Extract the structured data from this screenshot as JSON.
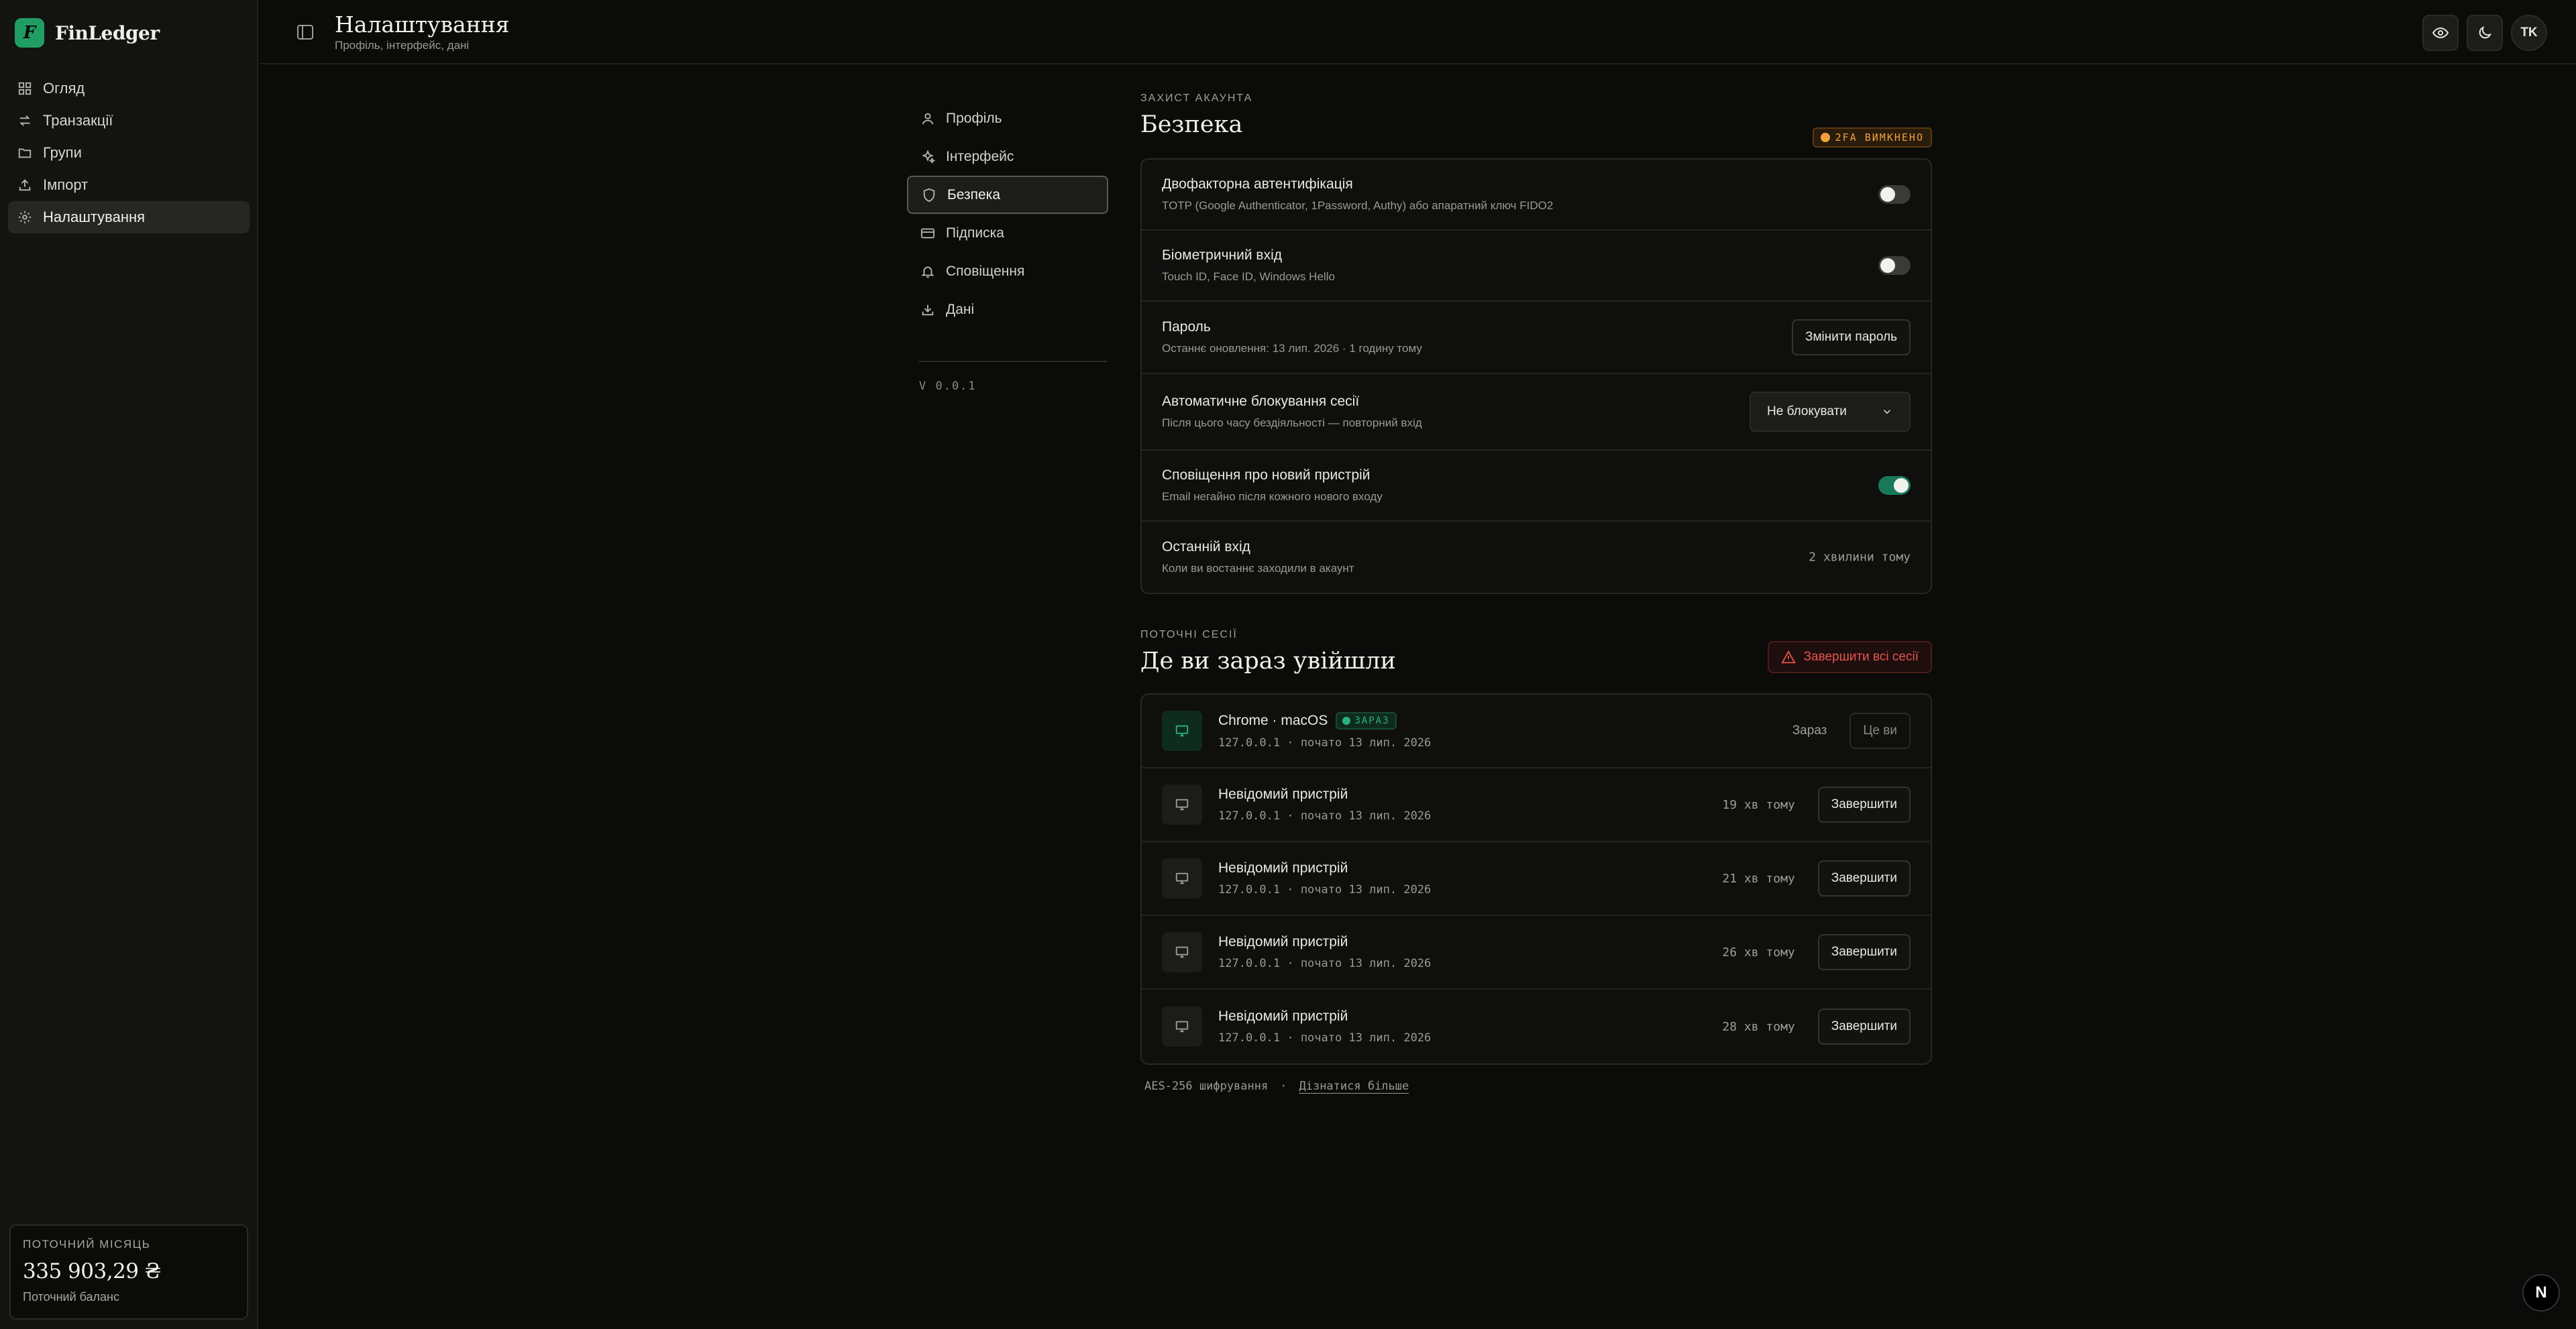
{
  "app": {
    "name": "FinLedger",
    "logo_letter": "F"
  },
  "sidebar": {
    "items": [
      {
        "label": "Огляд",
        "icon": "grid-icon",
        "active": false
      },
      {
        "label": "Транзакції",
        "icon": "arrows-icon",
        "active": false
      },
      {
        "label": "Групи",
        "icon": "folder-icon",
        "active": false
      },
      {
        "label": "Імпорт",
        "icon": "upload-icon",
        "active": false
      },
      {
        "label": "Налаштування",
        "icon": "gear-icon",
        "active": true
      }
    ],
    "balance": {
      "label": "ПОТОЧНИЙ МІСЯЦЬ",
      "value": "335 903,29 ₴",
      "sub": "Поточний баланс"
    }
  },
  "header": {
    "title": "Налаштування",
    "subtitle": "Профіль, інтерфейс, дані",
    "avatar": "TK"
  },
  "settings_nav": {
    "items": [
      {
        "label": "Профіль",
        "icon": "user-icon"
      },
      {
        "label": "Інтерфейс",
        "icon": "sparkles-icon"
      },
      {
        "label": "Безпека",
        "icon": "shield-icon",
        "active": true
      },
      {
        "label": "Підписка",
        "icon": "card-icon"
      },
      {
        "label": "Сповіщення",
        "icon": "bell-icon"
      },
      {
        "label": "Дані",
        "icon": "download-icon"
      }
    ],
    "version": "V 0.0.1"
  },
  "security": {
    "eyebrow": "ЗАХИСТ АКАУНТА",
    "title": "Безпека",
    "badge": "2FA ВИМКНЕНО",
    "badge_color": "#f0a13a",
    "rows": [
      {
        "title": "Двофакторна автентифікація",
        "desc": "TOTP (Google Authenticator, 1Password, Authy) або апаратний ключ FIDO2",
        "toggle": false
      },
      {
        "title": "Біометричний вхід",
        "desc": "Touch ID, Face ID, Windows Hello",
        "toggle": false
      },
      {
        "title": "Пароль",
        "desc": "Останнє оновлення: 13 лип. 2026 · 1 годину тому",
        "button": "Змінити пароль"
      },
      {
        "title": "Автоматичне блокування сесії",
        "desc": "Після цього часу бездіяльності — повторний вхід",
        "select": "Не блокувати"
      },
      {
        "title": "Сповіщення про новий пристрій",
        "desc": "Email негайно після кожного нового входу",
        "toggle": true
      },
      {
        "title": "Останній вхід",
        "desc": "Коли ви востаннє заходили в акаунт",
        "value": "2 хвилини тому"
      }
    ]
  },
  "sessions": {
    "eyebrow": "ПОТОЧНІ СЕСІЇ",
    "title": "Де ви зараз увійшли",
    "end_all": "Завершити всі сесії",
    "current_badge": "ЗАРАЗ",
    "items": [
      {
        "name": "Chrome · macOS",
        "meta": "127.0.0.1 · почато 13 лип. 2026",
        "time": "Зараз",
        "action": "Це ви",
        "current": true
      },
      {
        "name": "Невідомий пристрій",
        "meta": "127.0.0.1 · почато 13 лип. 2026",
        "time": "19 хв тому",
        "action": "Завершити"
      },
      {
        "name": "Невідомий пристрій",
        "meta": "127.0.0.1 · почато 13 лип. 2026",
        "time": "21 хв тому",
        "action": "Завершити"
      },
      {
        "name": "Невідомий пристрій",
        "meta": "127.0.0.1 · почато 13 лип. 2026",
        "time": "26 хв тому",
        "action": "Завершити"
      },
      {
        "name": "Невідомий пристрій",
        "meta": "127.0.0.1 · почато 13 лип. 2026",
        "time": "28 хв тому",
        "action": "Завершити"
      }
    ]
  },
  "footer": {
    "encryption": "AES-256 шифрування",
    "separator": "·",
    "learn_more": "Дізнатися більше"
  },
  "corner_badge": "N",
  "colors": {
    "accent": "#1f9d63",
    "danger": "#e5544c",
    "warning": "#f0a13a"
  }
}
